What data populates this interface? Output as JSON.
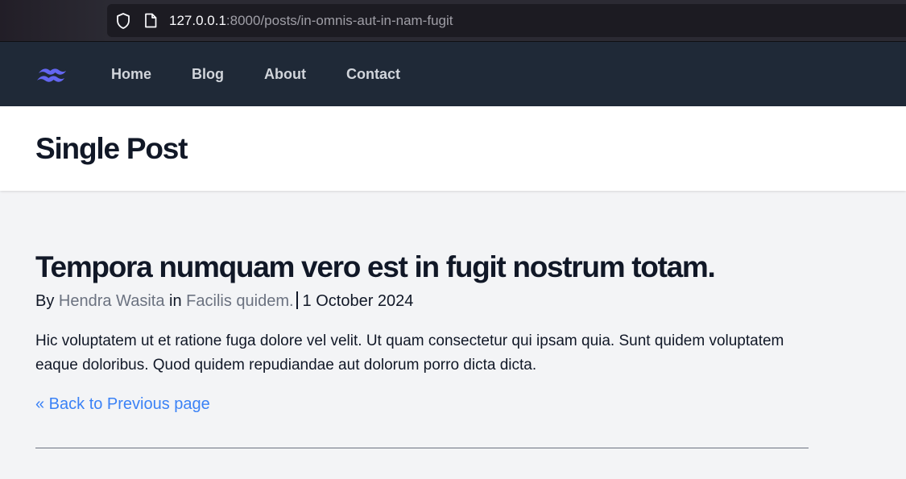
{
  "browser": {
    "url_host": "127.0.0.1",
    "url_path": ":8000/posts/in-omnis-aut-in-nam-fugit",
    "icons": [
      "shield-icon",
      "page-icon"
    ]
  },
  "nav": {
    "logo_icon": "tailwind-logo-icon",
    "links": [
      {
        "label": "Home"
      },
      {
        "label": "Blog"
      },
      {
        "label": "About"
      },
      {
        "label": "Contact"
      }
    ]
  },
  "header": {
    "title": "Single Post"
  },
  "post": {
    "title": "Tempora numquam vero est in fugit nostrum totam.",
    "by_label": "By",
    "author": "Hendra Wasita",
    "in_label": "in",
    "category": "Facilis quidem.",
    "date": "1 October 2024",
    "body": "Hic voluptatem ut et ratione fuga dolore vel velit. Ut quam consectetur qui ipsam quia. Sunt quidem voluptatem eaque doloribus. Quod quidem repudiandae aut dolorum porro dicta dicta.",
    "back_label": "« Back to Previous page"
  },
  "colors": {
    "nav_bg": "#1f2937",
    "link_blue": "#3b82f6",
    "meta_gray": "#6b7280",
    "logo": "#6366f1"
  }
}
